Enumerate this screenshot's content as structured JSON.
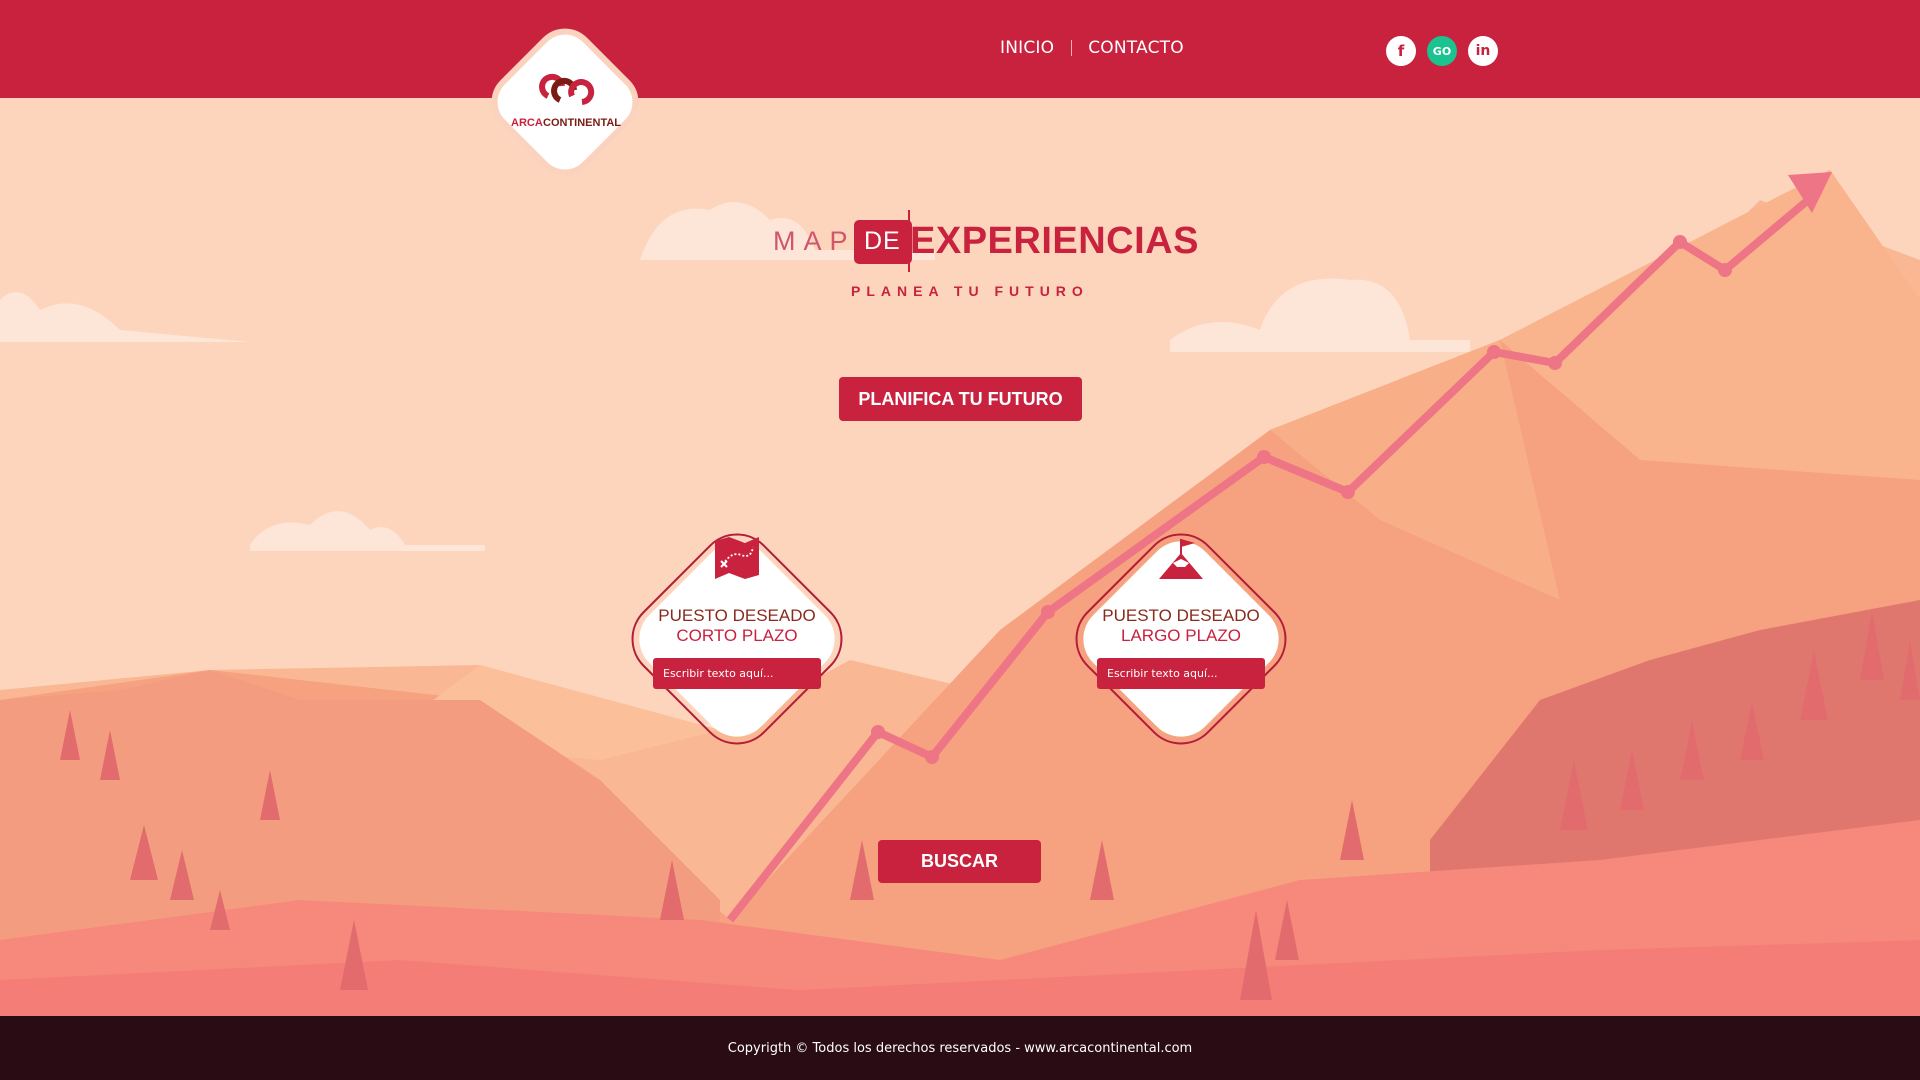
{
  "brand": {
    "logo_text_arca": "ARCA",
    "logo_text_continental": "CONTINENTAL",
    "primary_color": "#c8223f"
  },
  "nav": {
    "items": [
      {
        "label": "INICIO"
      },
      {
        "label": "CONTACTO"
      }
    ]
  },
  "social": [
    {
      "icon": "facebook-icon",
      "glyph": "f"
    },
    {
      "icon": "go-icon",
      "glyph": "GO"
    },
    {
      "icon": "linkedin-icon",
      "glyph": "in"
    }
  ],
  "hero": {
    "title_part1": "MAPA",
    "title_part2": "DE",
    "title_part3": "EXPERIENCIAS",
    "subtitle": "PLANEA TU FUTURO",
    "cta_label": "PLANIFICA TU FUTURO"
  },
  "cards": [
    {
      "icon": "treasure-map-icon",
      "line1": "PUESTO DESEADO",
      "line2": "CORTO PLAZO",
      "placeholder": "Escribir texto aquí..."
    },
    {
      "icon": "mountain-flag-icon",
      "line1": "PUESTO DESEADO",
      "line2": "LARGO PLAZO",
      "placeholder": "Escribir texto aquí..."
    }
  ],
  "search": {
    "label": "BUSCAR"
  },
  "footer": {
    "text": "Copyrigth © Todos los derechos reservados - www.arcacontinental.com"
  }
}
